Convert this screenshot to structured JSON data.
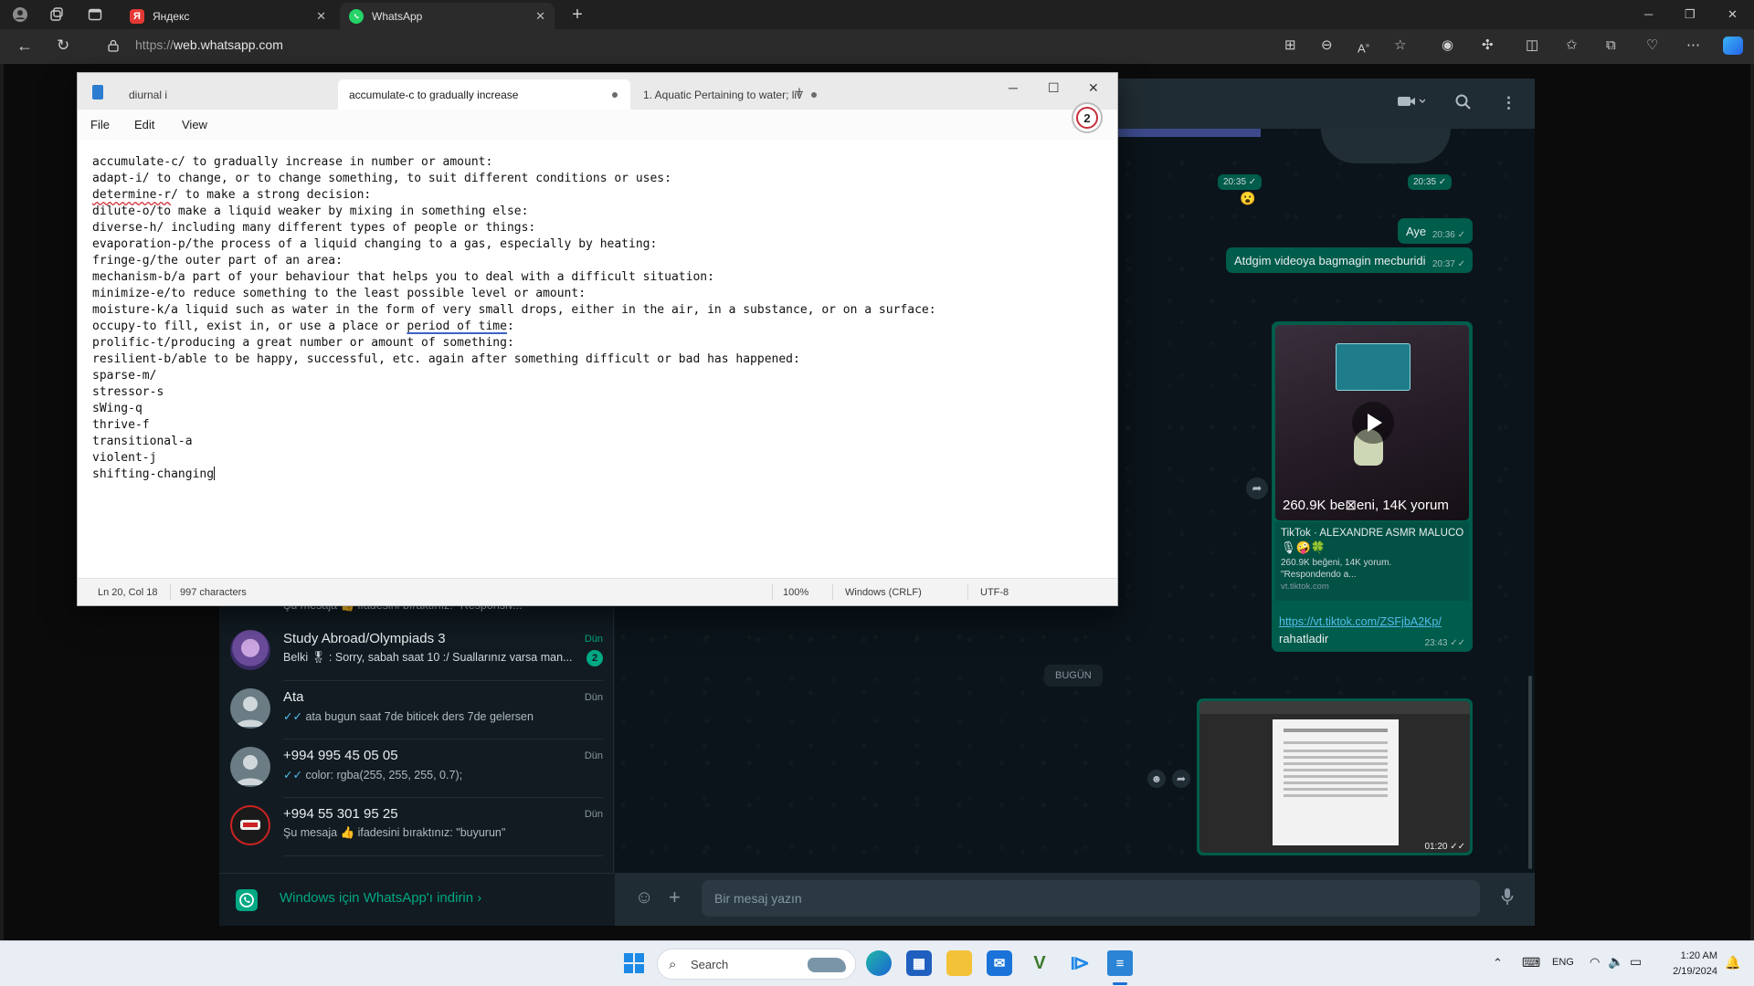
{
  "browser": {
    "tabs": [
      {
        "label": "Яндекс",
        "favicon": "yandex-icon"
      },
      {
        "label": "WhatsApp",
        "favicon": "whatsapp-icon"
      }
    ],
    "url_scheme": "https://",
    "url_host": "web.whatsapp.com"
  },
  "notepad": {
    "tabs": [
      {
        "label": "diurnal i"
      },
      {
        "label": "accumulate-c to gradually increase"
      },
      {
        "label": "1. Aquatic Pertaining to water; liv"
      }
    ],
    "menu": [
      "File",
      "Edit",
      "View"
    ],
    "badge_count": "2",
    "lines": [
      "accumulate-c/ to gradually increase in number or amount:",
      "adapt-i/ to change, or to change something, to suit different conditions or uses:",
      {
        "pre": "",
        "mark": "determine-r",
        "post": "/ to make a strong decision:"
      },
      "dilute-o/to make a liquid weaker by mixing in something else:",
      "diverse-h/ including many different types of people or things:",
      "evaporation-p/the process of a liquid changing to a gas, especially by heating:",
      "fringe-g/the outer part of an area:",
      "mechanism-b/a part of your behaviour that helps you to deal with a difficult situation:",
      "minimize-e/to reduce something to the least possible level or amount:",
      "moisture-k/a liquid such as water in the form of very small drops, either in the air, in a substance, or on a surface:",
      {
        "pre": "occupy-to fill, exist in, or use a place or ",
        "blue": "period of time",
        "post": ":"
      },
      "prolific-t/producing a great number or amount of something:",
      "resilient-b/able to be happy, successful, etc. again after something difficult or bad has happened:",
      "sparse-m/",
      "stressor-s",
      "sWing-q",
      "thrive-f",
      "transitional-a",
      "violent-j",
      "shifting-changing"
    ],
    "status": {
      "position": "Ln 20, Col 18",
      "characters": "997 characters",
      "zoom": "100%",
      "line_ending": "Windows (CRLF)",
      "encoding": "UTF-8"
    }
  },
  "whatsapp": {
    "chats": [
      {
        "name": "Study Abroad/Olympiads 3",
        "time": "Dün",
        "preview": "Belki 🎖 : Sorry, sabah saat 10 :/ Suallarınız varsa man...",
        "unread": "2"
      },
      {
        "name": "Ata",
        "time": "Dün",
        "preview": "ata bugun saat 7de biticek ders 7de gelersen",
        "ticks": "✓✓"
      },
      {
        "name": "+994 995 45 05 05",
        "time": "Dün",
        "preview": "color: rgba(255, 255, 255, 0.7);",
        "ticks": "✓✓"
      },
      {
        "name": "+994 55 301 95 25",
        "time": "Dün",
        "preview": "Şu mesaja 👍 ifadesini bıraktınız: \"buyurun\""
      }
    ],
    "partial_preview": "Şu mesaja 👍 ifadesini bıraktınız: \"Responsiv...\"",
    "download_text": "Windows için WhatsApp'ı indirin",
    "messages": {
      "time_a": "20:35 ✓",
      "time_b": "20:35 ✓",
      "emoji": "😮",
      "aye": {
        "text": "Aye",
        "time": "20:36 ✓"
      },
      "atdgim": {
        "text": "Atdgim videoya bagmagin mecburidi",
        "time": "20:37 ✓"
      },
      "tiktok": {
        "overlay": "260.9K be⊠eni, 14K yorum",
        "source": "TikTok · ALEXANDRE ASMR MALUCO",
        "emojis": "🎙🤪🍀",
        "desc_line1": "260.9K beğeni, 14K yorum.",
        "desc_line2": "\"Respondendo a...",
        "domain": "vt.tiktok.com",
        "link": "https://vt.tiktok.com/ZSFjbA2Kp/",
        "text": "rahatladir",
        "time": "23:43 ✓✓"
      },
      "day_divider": "BUGÜN",
      "video_time": "01:20 ✓✓"
    },
    "composer_placeholder": "Bir mesaj yazın"
  },
  "taskbar": {
    "search_label": "Search",
    "language": "ENG",
    "time": "1:20 AM",
    "date": "2/19/2024"
  }
}
